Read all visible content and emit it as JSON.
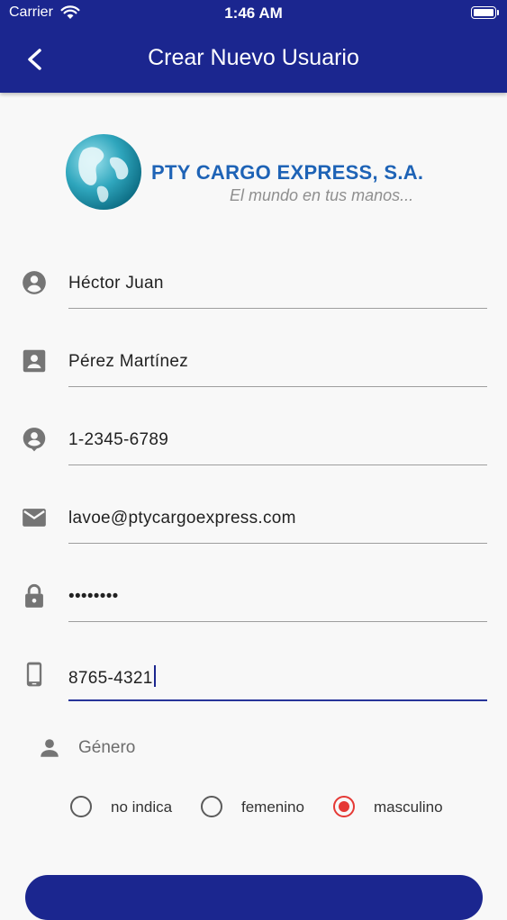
{
  "status_bar": {
    "carrier": "Carrier",
    "time": "1:46 AM"
  },
  "header": {
    "title": "Crear Nuevo Usuario",
    "back_icon": "chevron-left-icon"
  },
  "logo": {
    "company": "PTY CARGO EXPRESS, S.A.",
    "tagline": "El mundo en tus manos..."
  },
  "form": {
    "fields": [
      {
        "icon": "account-circle-icon",
        "value": "Héctor Juan"
      },
      {
        "icon": "contact-card-icon",
        "value": "Pérez Martínez"
      },
      {
        "icon": "person-pin-icon",
        "value": "1-2345-6789"
      },
      {
        "icon": "email-icon",
        "value": "lavoe@ptycargoexpress.com"
      },
      {
        "icon": "lock-icon",
        "value": "••••••••"
      },
      {
        "icon": "phone-icon",
        "value": "8765-4321"
      }
    ],
    "gender": {
      "label": "Género",
      "options": [
        "no indica",
        "femenino",
        "masculino"
      ],
      "selected": "masculino"
    }
  },
  "colors": {
    "primary": "#1b268f",
    "accent": "#e53935",
    "background": "#f8f8f8"
  }
}
